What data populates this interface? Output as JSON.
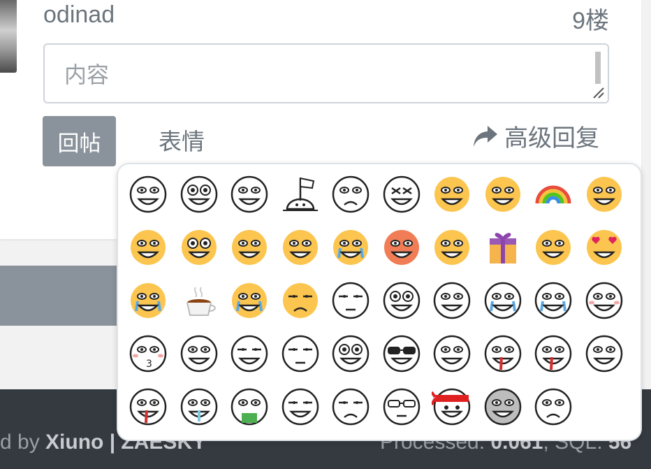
{
  "post": {
    "username": "odinad",
    "floor": "9楼"
  },
  "reply": {
    "placeholder": "内容",
    "submit_label": "回帖",
    "emoji_label": "表情",
    "advanced_label": "高级回复"
  },
  "footer": {
    "left_prefix": "d by ",
    "left_brand": "Xiuno | ZAESKY",
    "right_label": "Processed: ",
    "processed": "0.061",
    "sql_label": ", SQL: ",
    "sql": "56"
  },
  "emoji_panel": {
    "rows": [
      [
        "grin",
        "round-eyes",
        "smile",
        "white-flag",
        "frown",
        "x-eyes",
        "squint-yellow",
        "sneeze-yellow",
        "rainbow",
        "rainbow-vomit"
      ],
      [
        "smile-yellow",
        "puppy-eyes",
        "shy-yellow",
        "sweat-yellow",
        "crying-yellow",
        "smirk-orange",
        "smile-yellow-2",
        "gift-box",
        "question-yellow",
        "heart-eyes"
      ],
      [
        "sad-tears-yellow",
        "coffee-cup",
        "fear-yellow",
        "unamused-yellow",
        "neutral",
        "goggle-eyes",
        "toothy-grin",
        "cry-tears",
        "laugh-tears",
        "blush"
      ],
      [
        "kiss",
        "sweat-grin",
        "smug",
        "bored",
        "shocked",
        "sunglasses",
        "heart-hand",
        "bleeding-heart",
        "nosebleed",
        "drool"
      ],
      [
        "bleeding-nose",
        "snot",
        "vomit",
        "sly",
        "hmm",
        "glasses",
        "headband",
        "gray-face",
        "sad"
      ]
    ],
    "colors": {
      "yellow": "#fbc54f",
      "orange": "#f07d56"
    }
  }
}
